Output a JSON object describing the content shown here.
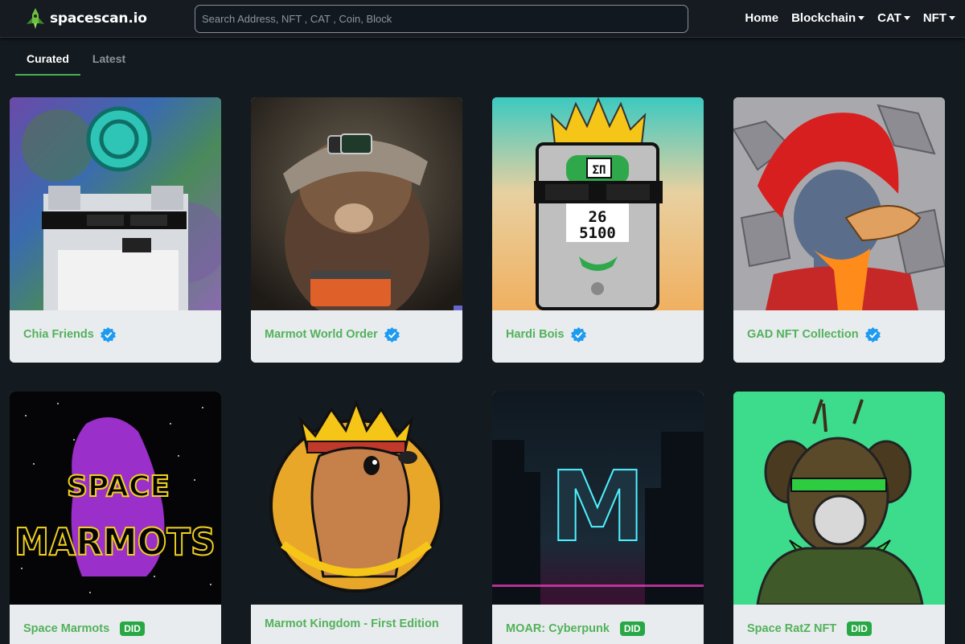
{
  "brand": {
    "name": "spacescan.io",
    "logo_icon": "rocket-logo-icon"
  },
  "search": {
    "placeholder": "Search Address, NFT , CAT , Coin, Block"
  },
  "nav": {
    "home": "Home",
    "blockchain": "Blockchain",
    "cat": "CAT",
    "nft": "NFT"
  },
  "tabs": {
    "curated": "Curated",
    "latest": "Latest",
    "active": "Curated"
  },
  "colors": {
    "accent": "#4caf50",
    "name_green": "#52b25a",
    "did_badge": "#28a745",
    "verified_blue": "#1d9bf0",
    "background": "#131a20",
    "card_footer": "#e9ecef"
  },
  "collections": [
    {
      "name": "Chia Friends",
      "badge": "verified"
    },
    {
      "name": "Marmot World Order",
      "badge": "verified"
    },
    {
      "name": "Hardi Bois",
      "badge": "verified"
    },
    {
      "name": "GAD NFT Collection",
      "badge": "verified"
    },
    {
      "name": "Space Marmots",
      "badge": "DID"
    },
    {
      "name": "Marmot Kingdom - First Edition",
      "badge": ""
    },
    {
      "name": "MOAR: Cyberpunk",
      "badge": "DID"
    },
    {
      "name": "Space RatZ NFT",
      "badge": "DID"
    }
  ],
  "image_text": {
    "hardi_top": "ΣΠ",
    "hardi_num1": "26",
    "hardi_num2": "5100",
    "space_word1": "SPACE",
    "space_word2": "MARMOTS",
    "moar_letter": "M"
  }
}
